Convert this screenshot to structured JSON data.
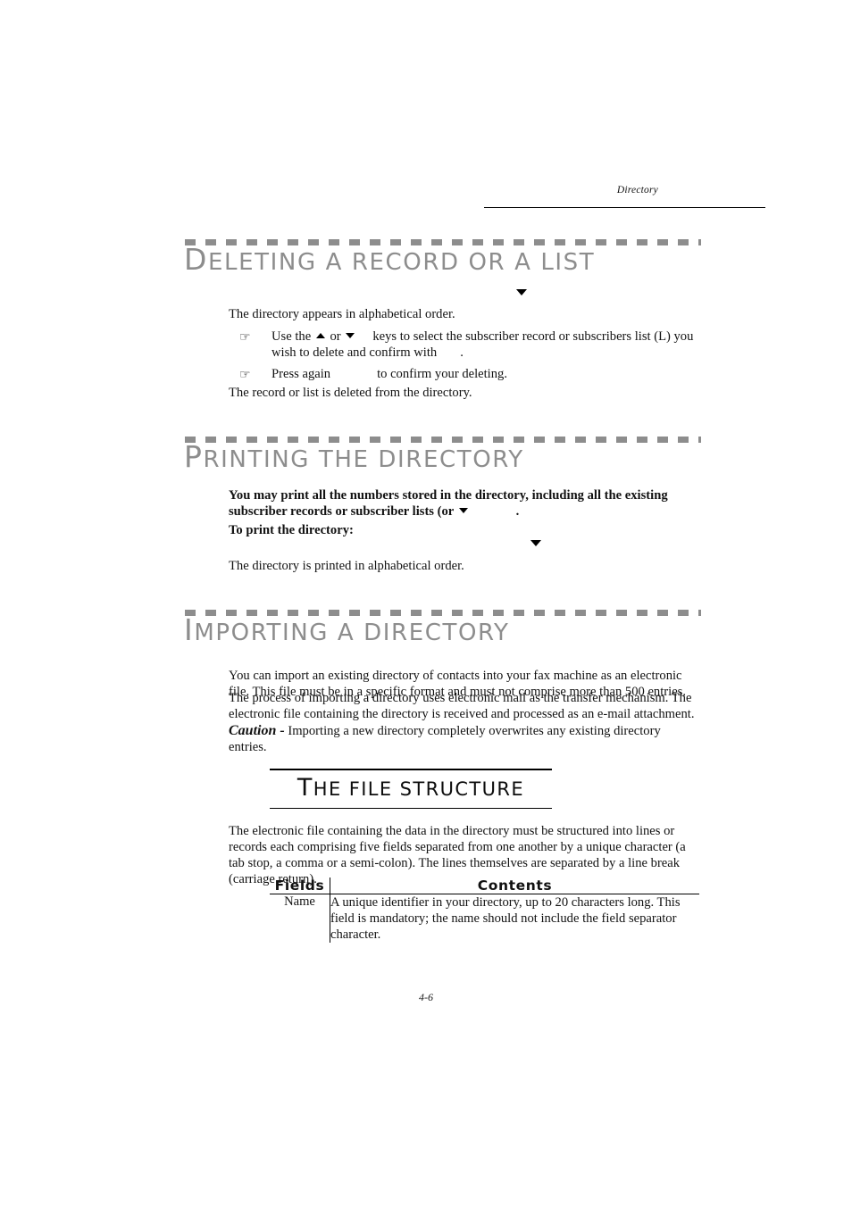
{
  "header": {
    "running_title": "Directory"
  },
  "sections": [
    {
      "id": "deleting",
      "title_cap": "D",
      "title_rest": "ELETING A RECORD OR A LIST",
      "intro": "The directory appears in alphabetical order.",
      "bullets": [
        {
          "icon": "pointing-hand-icon",
          "text_a": "Use the",
          "text_b": "or",
          "text_c": "keys to select the subscriber record or subscribers list (L) you wish to delete and confirm with",
          "text_d": "."
        },
        {
          "icon": "pointing-hand-icon",
          "text_a": "Press again",
          "text_b": "to confirm your deleting."
        }
      ],
      "outro": "The  record or list is deleted from the directory."
    },
    {
      "id": "printing",
      "title_cap": "P",
      "title_rest": "RINTING THE DIRECTORY",
      "lead_bold_a": "You may print all the numbers stored in the directory, including all the existing subscriber records or subscriber lists (or",
      "lead_bold_b": ".",
      "to_print_label": "To print the directory:",
      "outro": "The directory is printed in alphabetical order."
    },
    {
      "id": "importing",
      "title_cap": "I",
      "title_rest": "MPORTING A DIRECTORY",
      "paragraphs": [
        "You can import an existing directory of contacts into your fax machine as an electronic file. This file must be in a specific format and must not comprise more than 500 entries.",
        "The process of importing a directory uses electronic mail as the transfer mechanism. The electronic file containing the directory is received and processed as an e-mail attachment."
      ],
      "caution_label": "Caution -",
      "caution_text": "Importing a new directory completely overwrites any existing directory entries."
    }
  ],
  "subsection": {
    "title_cap": "T",
    "title_rest": "HE FILE STRUCTURE",
    "paragraph": "The electronic file containing the data in the directory must be structured into lines or records each comprising five fields separated from one another by a unique character (a tab stop, a comma or a semi-colon). The lines themselves are separated by a line break (carriage return)."
  },
  "table": {
    "columns": [
      "Fields",
      "Contents"
    ],
    "rows": [
      {
        "field": "Name",
        "contents": "A unique identifier in your directory, up to 20 characters long. This field is mandatory; the name should not include the field separator character."
      }
    ]
  },
  "footer": {
    "page_number": "4-6"
  },
  "colors": {
    "heading_gray": "#8d8d8d",
    "text_black": "#121212",
    "rule_black": "#000000"
  }
}
